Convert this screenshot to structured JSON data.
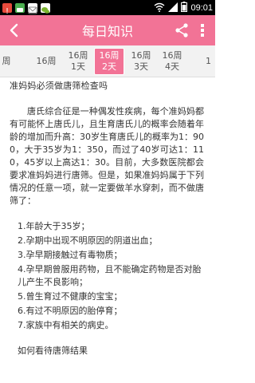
{
  "status_bar": {
    "time": "09:01",
    "icons_left": [
      "notification-icon",
      "chat-icon",
      "message-icon",
      "wechat-icon"
    ],
    "icons_right": [
      "wifi-icon",
      "signal-icon",
      "battery-icon"
    ]
  },
  "app_bar": {
    "title": "每日知识",
    "back_icon": "chevron-left-icon",
    "share_icon": "share-icon",
    "more_icon": "more-vertical-icon"
  },
  "tabs": [
    {
      "line1": "周",
      "line2": "",
      "active": false,
      "clipped": true
    },
    {
      "line1": "16周",
      "line2": "",
      "active": false,
      "clipped": false
    },
    {
      "line1": "16周",
      "line2": "1天",
      "active": false,
      "clipped": false
    },
    {
      "line1": "16周",
      "line2": "2天",
      "active": true,
      "clipped": false
    },
    {
      "line1": "16周",
      "line2": "3天",
      "active": false,
      "clipped": false
    },
    {
      "line1": "16周",
      "line2": "4天",
      "active": false,
      "clipped": false
    },
    {
      "line1": "1",
      "line2": "",
      "active": false,
      "clipped": true
    }
  ],
  "article": {
    "heading": "准妈妈必须做唐筛检查吗",
    "paragraph": "唐氏综合征是一种偶发性疾病，每个准妈妈都有可能怀上唐氏儿，且生育唐氏儿的概率会随着年龄的增加而升高：30岁生育唐氏儿的概率为1：900，大于35岁为1：350，而过了40岁可达1：110，45岁以上高达1：30。目前，大多数医院都会要求准妈妈进行唐筛。但是，如果准妈妈属于下列情况的任意一项，就一定要做羊水穿刺，而不做唐筛了：",
    "list": [
      "1.年龄大于35岁；",
      "2.孕期中出现不明原因的阴道出血；",
      "3.孕早期接触过有毒物质；",
      "4.孕早期曾服用药物，且不能确定药物是否对胎儿产生不良影响；",
      "5.曾生育过不健康的宝宝；",
      "6.有过不明原因的胎停育；",
      "7.家族中有相关的病史。"
    ],
    "heading2": "如何看待唐筛结果"
  },
  "colors": {
    "accent": "#f27396",
    "status_bar": "#000000",
    "tab_strip": "#f2f2f2",
    "text": "#333333"
  }
}
